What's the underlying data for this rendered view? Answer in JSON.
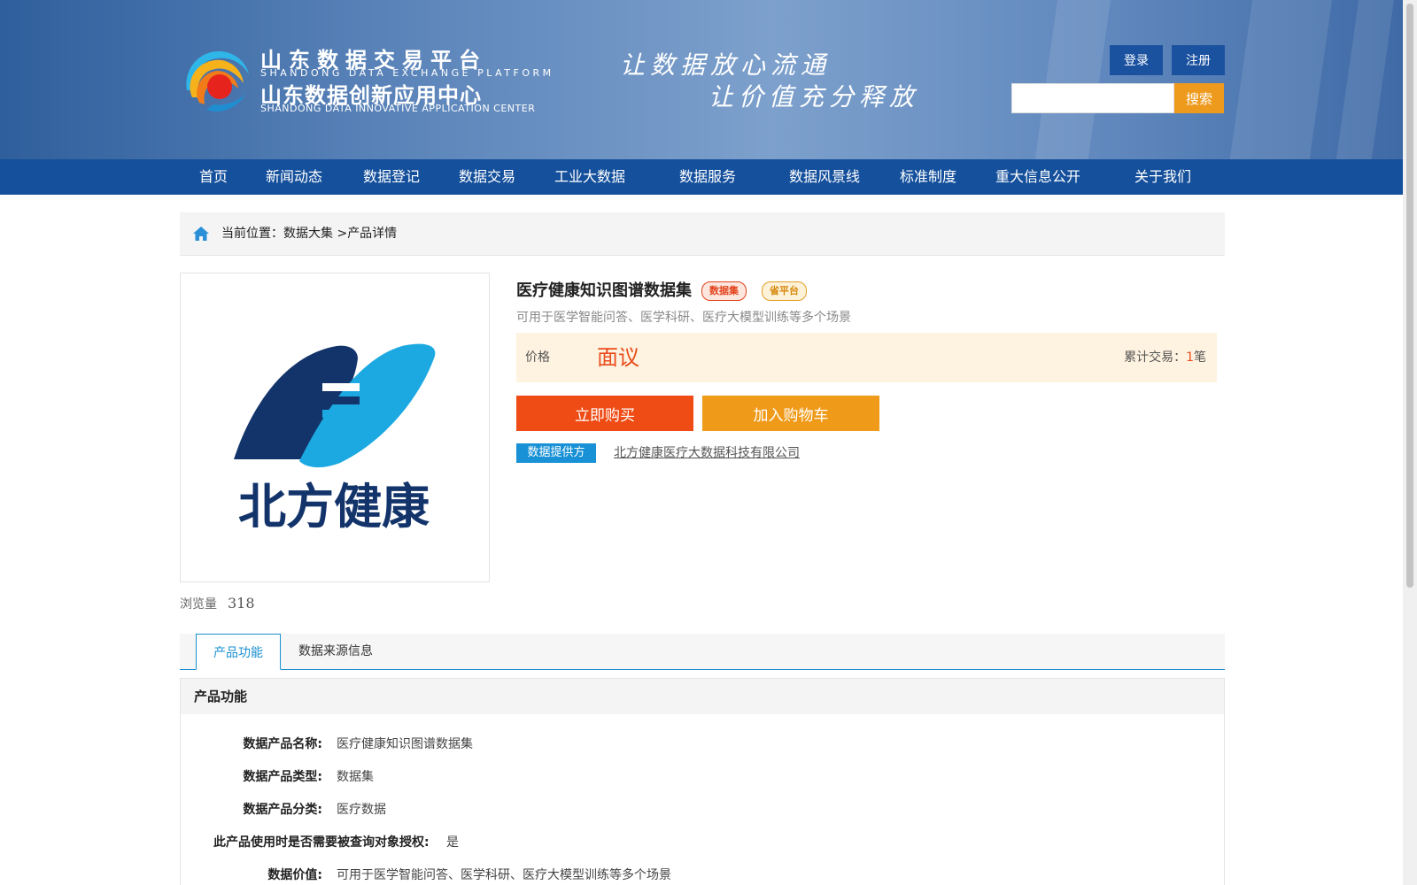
{
  "header": {
    "logo_cn_line1": "山东数据交易平台",
    "logo_en_line1": "SHANDONG DATA EXCHANGE PLATFORM",
    "logo_cn_line2": "山东数据创新应用中心",
    "logo_en_line2": "SHANDONG DATA INNOVATIVE APPLICATION CENTER",
    "slogan_line1": "让数据放心流通",
    "slogan_line2": "让价值充分释放",
    "login_label": "登录",
    "register_label": "注册",
    "search_placeholder": "",
    "search_button": "搜索"
  },
  "nav": {
    "items": [
      "首页",
      "新闻动态",
      "数据登记",
      "数据交易",
      "工业大数据",
      "数据服务",
      "数据风景线",
      "标准制度",
      "重大信息公开",
      "关于我们"
    ]
  },
  "breadcrumb": {
    "prefix": "当前位置：",
    "level1": "数据大集",
    "separator": ">",
    "level2": "产品详情"
  },
  "product": {
    "image_text": "北方健康",
    "views_label": "浏览量",
    "views": "318",
    "title": "医疗健康知识图谱数据集",
    "badge_type": "数据集",
    "badge_platform": "省平台",
    "subtitle": "可用于医学智能问答、医学科研、医疗大模型训练等多个场景",
    "price_label": "价格",
    "price_value": "面议",
    "trade_label": "累计交易：",
    "trade_count": "1",
    "trade_unit": "笔",
    "buy_label": "立即购买",
    "cart_label": "加入购物车",
    "provider_tag": "数据提供方",
    "provider_name": "北方健康医疗大数据科技有限公司"
  },
  "tabs": {
    "function": "产品功能",
    "source": "数据来源信息"
  },
  "panel": {
    "title": "产品功能",
    "rows": [
      {
        "k": "数据产品名称:",
        "v": "医疗健康知识图谱数据集"
      },
      {
        "k": "数据产品类型:",
        "v": "数据集"
      },
      {
        "k": "数据产品分类:",
        "v": "医疗数据"
      },
      {
        "k": "此产品使用时是否需要被查询对象授权:",
        "v": "是"
      },
      {
        "k": "数据价值:",
        "v": "可用于医学智能问答、医学科研、医疗大模型训练等多个场景"
      }
    ]
  },
  "colors": {
    "nav_blue": "#15509c",
    "accent_orange": "#ef4b14",
    "accent_amber": "#ef9a19",
    "link_blue": "#1a8fcf"
  }
}
